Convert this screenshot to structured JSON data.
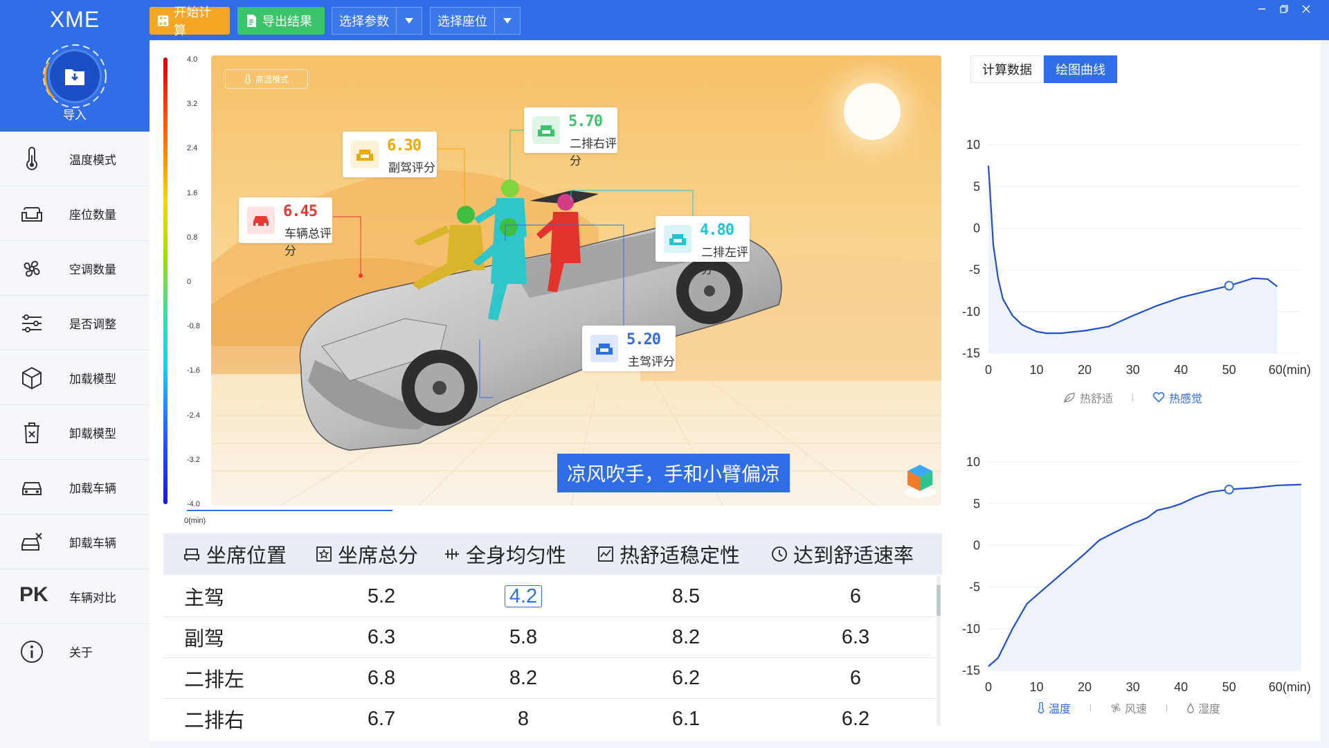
{
  "app": {
    "title": "XME",
    "import_label": "导入"
  },
  "toolbar": {
    "start_label": "开始计算",
    "export_label": "导出结果",
    "param_select": "选择参数",
    "seat_select": "选择座位"
  },
  "sidebar": {
    "items": [
      {
        "label": "温度模式",
        "icon": "thermometer-icon"
      },
      {
        "label": "座位数量",
        "icon": "sofa-icon"
      },
      {
        "label": "空调数量",
        "icon": "fan-icon"
      },
      {
        "label": "是否调整",
        "icon": "sliders-icon"
      },
      {
        "label": "加载模型",
        "icon": "cube-icon"
      },
      {
        "label": "卸载模型",
        "icon": "trash-icon"
      },
      {
        "label": "加载车辆",
        "icon": "car-icon"
      },
      {
        "label": "卸载车辆",
        "icon": "car-remove-icon"
      },
      {
        "label": "车辆对比",
        "icon": "pk-icon",
        "icon_text": "PK"
      },
      {
        "label": "关于",
        "icon": "info-icon"
      }
    ]
  },
  "scene": {
    "mode_label": "高温模式",
    "colorbar_ticks": [
      "4.0",
      "3.2",
      "2.4",
      "1.6",
      "0.8",
      "0",
      "-0.8",
      "-1.6",
      "-2.4",
      "-3.2",
      "-4.0"
    ],
    "timeline_label": "0(min)",
    "timeline_progress": 0.33,
    "feedback": "凉风吹手，手和小臂偏凉",
    "scores": {
      "total": {
        "value": "6.45",
        "label": "车辆总评分",
        "color": "#e8382f"
      },
      "passenger": {
        "value": "6.30",
        "label": "副驾评分",
        "color": "#f0a800"
      },
      "rear_right": {
        "value": "5.70",
        "label": "二排右评分",
        "color": "#3cc46b"
      },
      "rear_left": {
        "value": "4.80",
        "label": "二排左评分",
        "color": "#22c3d6"
      },
      "driver": {
        "value": "5.20",
        "label": "主驾评分",
        "color": "#2f6ee6"
      }
    }
  },
  "table": {
    "headers": [
      "坐席位置",
      "坐席总分",
      "全身均匀性",
      "热舒适稳定性",
      "达到舒适速率"
    ],
    "rows": [
      [
        "主驾",
        "5.2",
        "4.2",
        "8.5",
        "6"
      ],
      [
        "副驾",
        "6.3",
        "5.8",
        "8.2",
        "6.3"
      ],
      [
        "二排左",
        "6.8",
        "8.2",
        "6.2",
        "6"
      ],
      [
        "二排右",
        "6.7",
        "8",
        "6.1",
        "6.2"
      ]
    ]
  },
  "right_panel": {
    "tabs": [
      "计算数据",
      "绘图曲线"
    ],
    "active_tab": 1
  },
  "chart_data": [
    {
      "type": "line",
      "x": [
        0,
        1,
        2,
        3,
        5,
        7,
        10,
        12,
        15,
        20,
        25,
        30,
        35,
        40,
        45,
        50,
        55,
        58,
        60
      ],
      "y": [
        7.5,
        -2,
        -6,
        -8.5,
        -10.5,
        -11.6,
        -12.4,
        -12.6,
        -12.6,
        -12.3,
        -11.8,
        -10.5,
        -9.3,
        -8.3,
        -7.6,
        -6.9,
        -6,
        -6.1,
        -7
      ],
      "marker": {
        "x": 50,
        "y": -6.9
      },
      "xticks": [
        "0",
        "10",
        "20",
        "30",
        "40",
        "50",
        "60(min)"
      ],
      "yticks": [
        "10",
        "5",
        "0",
        "-5",
        "-10",
        "-15"
      ],
      "xlim": [
        0,
        65
      ],
      "ylim": [
        -15,
        12
      ],
      "legend": [
        {
          "name": "热舒适",
          "active": false
        },
        {
          "name": "热感觉",
          "active": true
        }
      ]
    },
    {
      "type": "line",
      "x": [
        0,
        2,
        5,
        8,
        12,
        16,
        20,
        23,
        26,
        30,
        33,
        35,
        38,
        40,
        43,
        46,
        50,
        52,
        55,
        60,
        65
      ],
      "y": [
        -14.5,
        -13.5,
        -10,
        -7,
        -5,
        -3,
        -1,
        0.6,
        1.5,
        2.6,
        3.3,
        4.2,
        4.6,
        5,
        5.8,
        6.4,
        6.7,
        6.8,
        6.9,
        7.2,
        7.3
      ],
      "marker": {
        "x": 50,
        "y": 6.7
      },
      "xticks": [
        "0",
        "10",
        "20",
        "30",
        "40",
        "50",
        "60(min)"
      ],
      "yticks": [
        "10",
        "5",
        "0",
        "-5",
        "-10",
        "-15"
      ],
      "xlim": [
        0,
        65
      ],
      "ylim": [
        -15,
        12
      ],
      "legend": [
        {
          "name": "温度",
          "active": true
        },
        {
          "name": "风速",
          "active": false
        },
        {
          "name": "湿度",
          "active": false
        }
      ]
    }
  ]
}
